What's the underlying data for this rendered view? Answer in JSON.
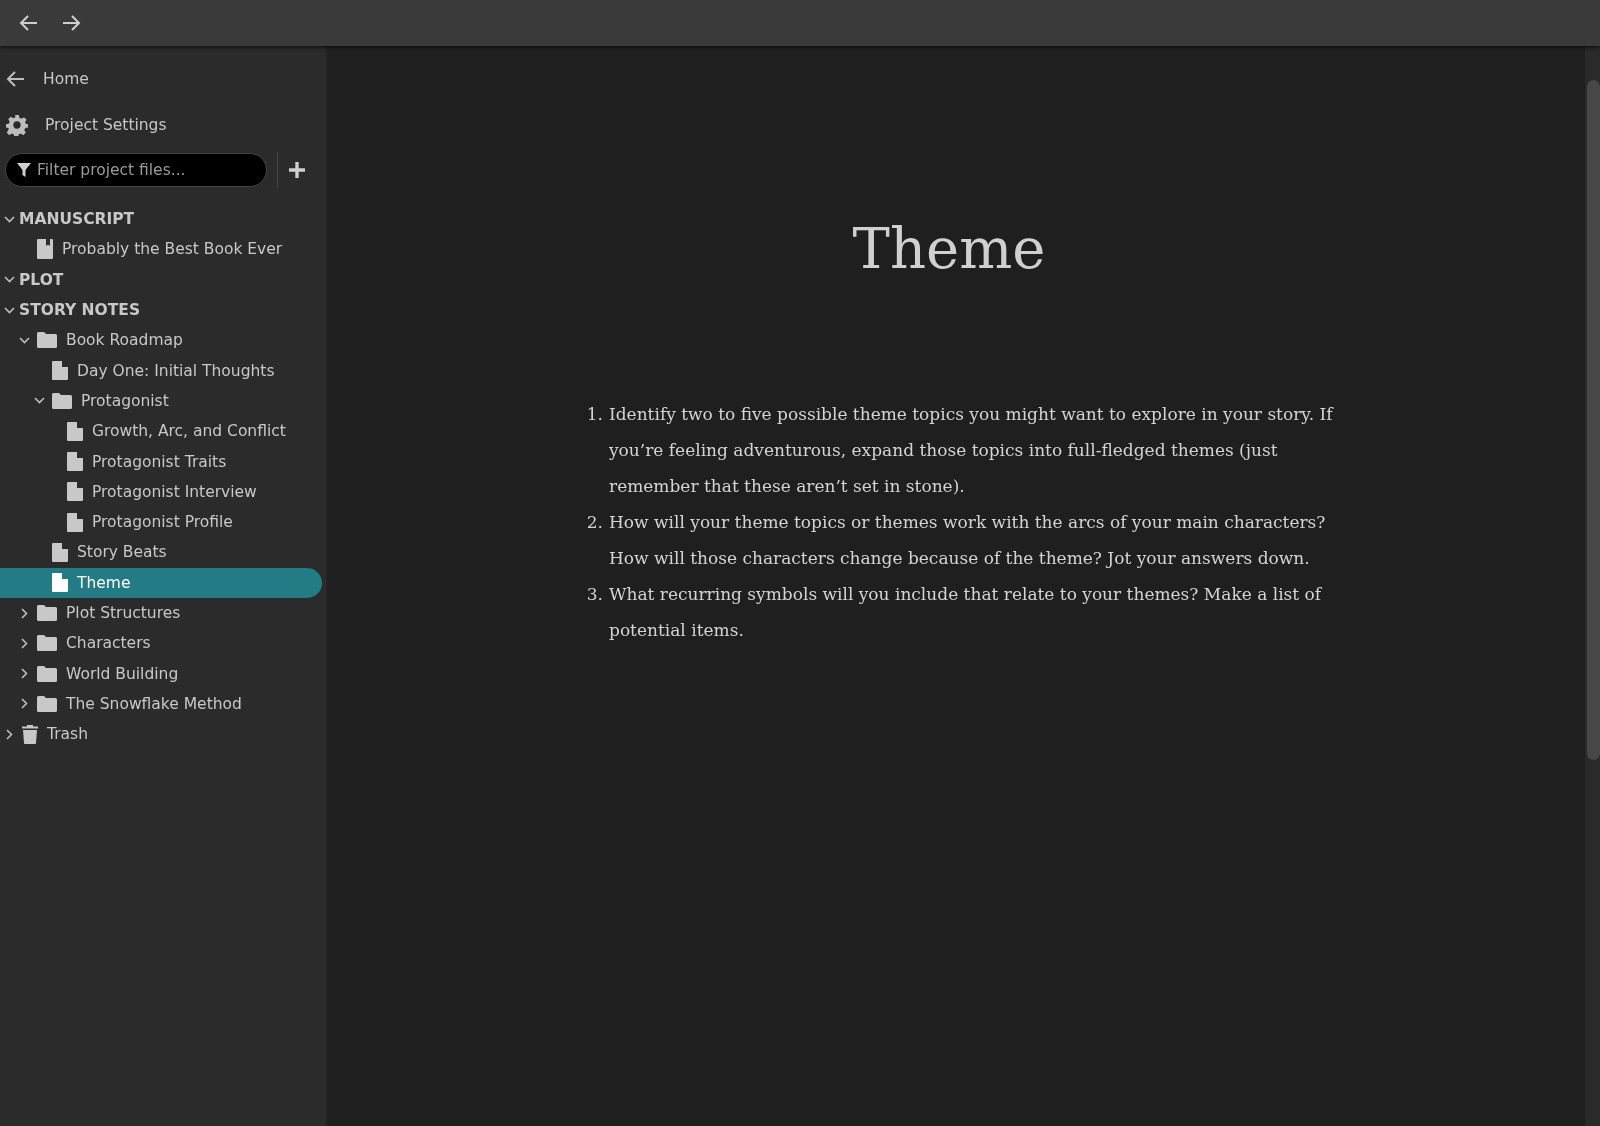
{
  "sidebar": {
    "home_link": "Home",
    "settings_link": "Project Settings",
    "filter": {
      "placeholder": "Filter project files..."
    },
    "tree": [
      {
        "kind": "section",
        "label": "MANUSCRIPT",
        "expanded": true,
        "selected": false,
        "children": [
          {
            "kind": "book",
            "label": "Probably the Best Book Ever",
            "selected": false
          }
        ]
      },
      {
        "kind": "section",
        "label": "PLOT",
        "expanded": true,
        "selected": false
      },
      {
        "kind": "section",
        "label": "STORY NOTES",
        "expanded": true,
        "selected": false,
        "children": [
          {
            "kind": "folder",
            "label": "Book Roadmap",
            "expanded": true,
            "selected": false,
            "children": [
              {
                "kind": "file",
                "label": "Day One: Initial Thoughts",
                "selected": false
              },
              {
                "kind": "folder",
                "label": "Protagonist",
                "expanded": true,
                "selected": false,
                "children": [
                  {
                    "kind": "file",
                    "label": "Growth, Arc, and Conflict",
                    "selected": false
                  },
                  {
                    "kind": "file",
                    "label": "Protagonist Traits",
                    "selected": false
                  },
                  {
                    "kind": "file",
                    "label": "Protagonist Interview",
                    "selected": false
                  },
                  {
                    "kind": "file",
                    "label": "Protagonist Profile",
                    "selected": false
                  }
                ]
              },
              {
                "kind": "file",
                "label": "Story Beats",
                "selected": false
              },
              {
                "kind": "file",
                "label": "Theme",
                "selected": true
              }
            ]
          },
          {
            "kind": "folder",
            "label": "Plot Structures",
            "expanded": false,
            "selected": false
          },
          {
            "kind": "folder",
            "label": "Characters",
            "expanded": false,
            "selected": false
          },
          {
            "kind": "folder",
            "label": "World Building",
            "expanded": false,
            "selected": false
          },
          {
            "kind": "folder",
            "label": "The Snowflake Method",
            "expanded": false,
            "selected": false
          }
        ]
      },
      {
        "kind": "trash",
        "label": "Trash",
        "expanded": false,
        "selected": false
      }
    ]
  },
  "document": {
    "title": "Theme",
    "list": [
      {
        "number": "1.",
        "text": "Identify two to five possible theme topics you might want to explore in your story. If you’re feeling adventurous, expand those topics into full-fledged themes (just remember that these aren’t set in stone)."
      },
      {
        "number": "2.",
        "text": "How will your theme topics or themes work with the arcs of your main characters? How will those characters change because of the theme? Jot your answers down."
      },
      {
        "number": "3.",
        "text": "What recurring symbols will you include that relate to your themes? Make a list of potential items."
      }
    ]
  }
}
